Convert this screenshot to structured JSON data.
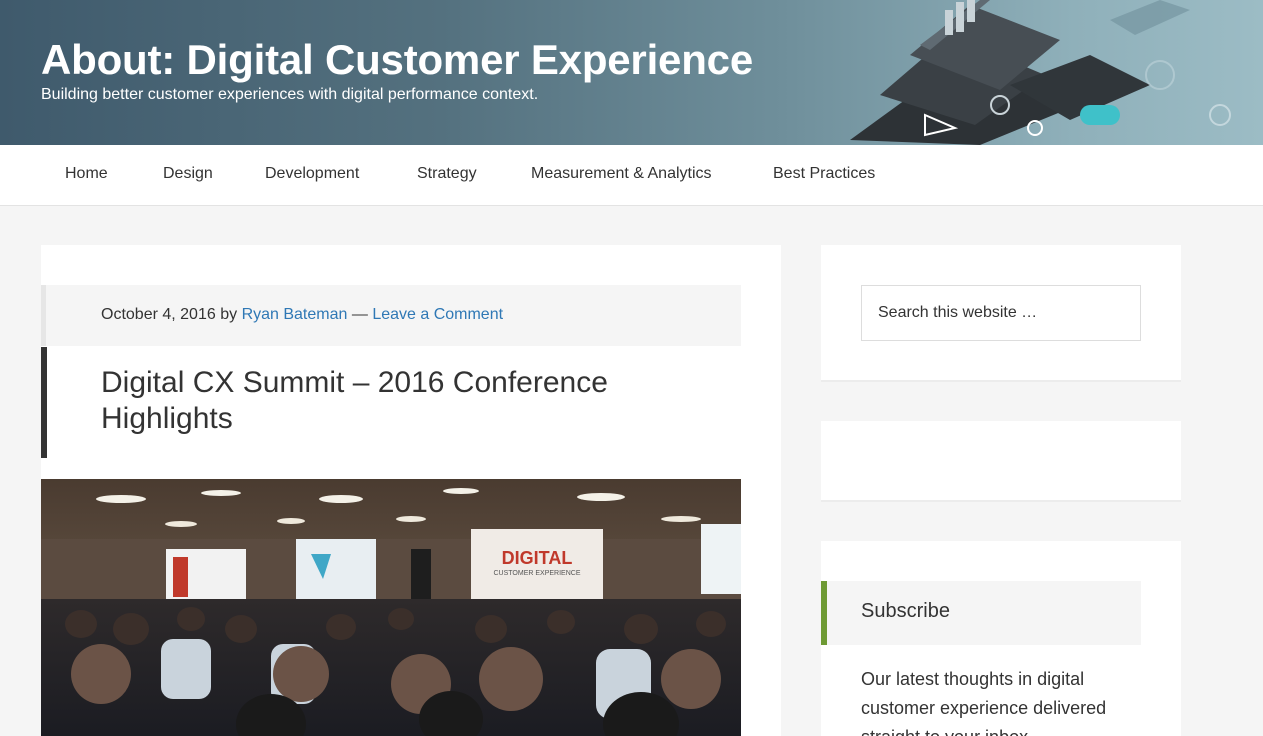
{
  "header": {
    "title": "About: Digital Customer Experience",
    "description": "Building better customer experiences with digital performance context."
  },
  "nav": {
    "items": [
      "Home",
      "Design",
      "Development",
      "Strategy",
      "Measurement & Analytics",
      "Best Practices"
    ]
  },
  "post": {
    "date": "October 4, 2016",
    "by": "by",
    "author": "Ryan Bateman",
    "separator": "—",
    "comment_link": "Leave a Comment",
    "title": "Digital CX Summit – 2016 Conference Highlights",
    "image": {
      "banner_word": "DIGITAL",
      "banner_sub": "CUSTOMER EXPERIENCE"
    }
  },
  "sidebar": {
    "search_placeholder": "Search this website …",
    "subscribe_title": "Subscribe",
    "subscribe_text": "Our latest thoughts in digital customer experience delivered straight to your inbox."
  },
  "colors": {
    "link": "#2f78b5",
    "title_accent": "#333333",
    "widget_accent": "#6e9a34"
  }
}
